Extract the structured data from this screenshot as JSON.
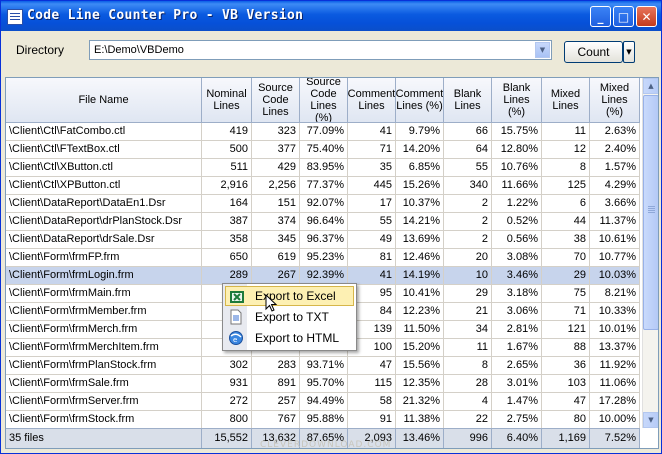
{
  "window": {
    "title": "Code Line Counter Pro - VB Version",
    "controls": {
      "minimize": "_",
      "maximize": "□",
      "close": "✕"
    }
  },
  "toolbar": {
    "directory_label": "Directory",
    "directory_value": "E:\\Demo\\VBDemo",
    "count_label": "Count"
  },
  "grid": {
    "columns": [
      "File Name",
      "Nominal Lines",
      "Source Code Lines",
      "Source Code Lines (%)",
      "Comment Lines",
      "Comment Lines (%)",
      "Blank Lines",
      "Blank Lines (%)",
      "Mixed Lines",
      "Mixed Lines (%)"
    ],
    "rows": [
      [
        "\\Client\\Ctl\\FatCombo.ctl",
        "419",
        "323",
        "77.09%",
        "41",
        "9.79%",
        "66",
        "15.75%",
        "11",
        "2.63%"
      ],
      [
        "\\Client\\Ctl\\FTextBox.ctl",
        "500",
        "377",
        "75.40%",
        "71",
        "14.20%",
        "64",
        "12.80%",
        "12",
        "2.40%"
      ],
      [
        "\\Client\\Ctl\\XButton.ctl",
        "511",
        "429",
        "83.95%",
        "35",
        "6.85%",
        "55",
        "10.76%",
        "8",
        "1.57%"
      ],
      [
        "\\Client\\Ctl\\XPButton.ctl",
        "2,916",
        "2,256",
        "77.37%",
        "445",
        "15.26%",
        "340",
        "11.66%",
        "125",
        "4.29%"
      ],
      [
        "\\Client\\DataReport\\DataEn1.Dsr",
        "164",
        "151",
        "92.07%",
        "17",
        "10.37%",
        "2",
        "1.22%",
        "6",
        "3.66%"
      ],
      [
        "\\Client\\DataReport\\drPlanStock.Dsr",
        "387",
        "374",
        "96.64%",
        "55",
        "14.21%",
        "2",
        "0.52%",
        "44",
        "11.37%"
      ],
      [
        "\\Client\\DataReport\\drSale.Dsr",
        "358",
        "345",
        "96.37%",
        "49",
        "13.69%",
        "2",
        "0.56%",
        "38",
        "10.61%"
      ],
      [
        "\\Client\\Form\\frmFP.frm",
        "650",
        "619",
        "95.23%",
        "81",
        "12.46%",
        "20",
        "3.08%",
        "70",
        "10.77%"
      ],
      [
        "\\Client\\Form\\frmLogin.frm",
        "289",
        "267",
        "92.39%",
        "41",
        "14.19%",
        "10",
        "3.46%",
        "29",
        "10.03%"
      ],
      [
        "\\Client\\Form\\frmMain.frm",
        "",
        "",
        "",
        "95",
        "10.41%",
        "29",
        "3.18%",
        "75",
        "8.21%"
      ],
      [
        "\\Client\\Form\\frmMember.frm",
        "",
        "",
        "",
        "84",
        "12.23%",
        "21",
        "3.06%",
        "71",
        "10.33%"
      ],
      [
        "\\Client\\Form\\frmMerch.frm",
        "",
        "",
        "",
        "139",
        "11.50%",
        "34",
        "2.81%",
        "121",
        "10.01%"
      ],
      [
        "\\Client\\Form\\frmMerchItem.frm",
        "",
        "",
        "",
        "100",
        "15.20%",
        "11",
        "1.67%",
        "88",
        "13.37%"
      ],
      [
        "\\Client\\Form\\frmPlanStock.frm",
        "302",
        "283",
        "93.71%",
        "47",
        "15.56%",
        "8",
        "2.65%",
        "36",
        "11.92%"
      ],
      [
        "\\Client\\Form\\frmSale.frm",
        "931",
        "891",
        "95.70%",
        "115",
        "12.35%",
        "28",
        "3.01%",
        "103",
        "11.06%"
      ],
      [
        "\\Client\\Form\\frmServer.frm",
        "272",
        "257",
        "94.49%",
        "58",
        "21.32%",
        "4",
        "1.47%",
        "47",
        "17.28%"
      ],
      [
        "\\Client\\Form\\frmStock.frm",
        "800",
        "767",
        "95.88%",
        "91",
        "11.38%",
        "22",
        "2.75%",
        "80",
        "10.00%"
      ]
    ],
    "selected_row": 8,
    "footer": [
      "35 files",
      "15,552",
      "13,632",
      "87.65%",
      "2,093",
      "13.46%",
      "996",
      "6.40%",
      "1,169",
      "7.52%"
    ]
  },
  "context_menu": {
    "items": [
      {
        "label": "Export to Excel",
        "icon": "excel-icon",
        "highlighted": true
      },
      {
        "label": "Export to TXT",
        "icon": "text-file-icon",
        "highlighted": false
      },
      {
        "label": "Export to HTML",
        "icon": "html-icon",
        "highlighted": false
      }
    ]
  },
  "watermark": "CLEVERDOWNLOAD.COM",
  "colors": {
    "title_bar": "#0a5ae0",
    "selection": "#c7d4ec",
    "menu_highlight": "#fdf0b3"
  }
}
